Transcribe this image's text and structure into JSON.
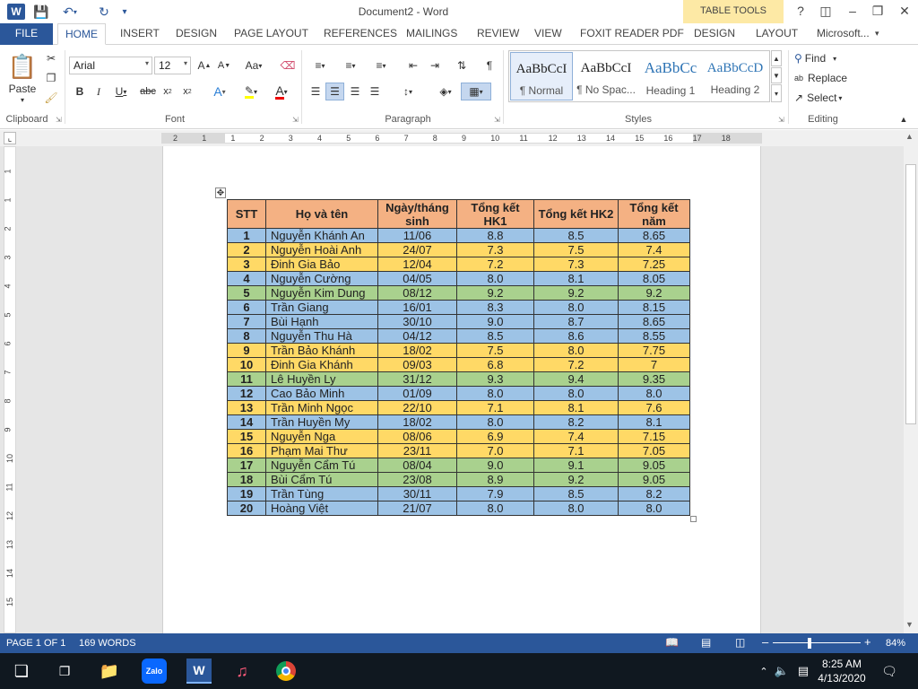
{
  "app": {
    "title": "Document2 - Word",
    "context_tab": "TABLE TOOLS",
    "logo_letter": "W"
  },
  "tabs": {
    "file": "FILE",
    "home": "HOME",
    "insert": "INSERT",
    "design": "DESIGN",
    "page_layout": "PAGE LAYOUT",
    "references": "REFERENCES",
    "mailings": "MAILINGS",
    "review": "REVIEW",
    "view": "VIEW",
    "foxit": "FOXIT READER PDF",
    "table_design": "DESIGN",
    "table_layout": "LAYOUT",
    "account": "Microsoft..."
  },
  "ribbon": {
    "paste": "Paste",
    "font_name": "Arial",
    "font_size": "12",
    "styles": [
      {
        "sample": "AaBbCcI",
        "name": "¶ Normal"
      },
      {
        "sample": "AaBbCcI",
        "name": "¶ No Spac..."
      },
      {
        "sample": "AaBbCc",
        "name": "Heading 1"
      },
      {
        "sample": "AaBbCcD",
        "name": "Heading 2"
      }
    ],
    "find": "Find",
    "replace": "Replace",
    "select": "Select",
    "groups": {
      "clipboard": "Clipboard",
      "font": "Font",
      "paragraph": "Paragraph",
      "styles": "Styles",
      "editing": "Editing"
    }
  },
  "ruler": {
    "marks": [
      "2",
      "1",
      "1",
      "2",
      "3",
      "4",
      "5",
      "6",
      "7",
      "8",
      "9",
      "10",
      "11",
      "12",
      "13",
      "14",
      "15",
      "16",
      "17",
      "18"
    ],
    "vmarks": [
      "1",
      "1",
      "2",
      "3",
      "4",
      "5",
      "6",
      "7",
      "8",
      "9",
      "10",
      "11",
      "12",
      "13",
      "14",
      "15"
    ]
  },
  "table": {
    "headers": [
      "STT",
      "Họ và tên",
      "Ngày/tháng sinh",
      "Tổng kết HK1",
      "Tổng kết HK2",
      "Tổng kết năm"
    ],
    "rows": [
      {
        "stt": "1",
        "name": "Nguyễn Khánh An",
        "dob": "11/06",
        "hk1": "8.8",
        "hk2": "8.5",
        "year": "8.65",
        "color": "blue"
      },
      {
        "stt": "2",
        "name": "Nguyễn Hoài Anh",
        "dob": "24/07",
        "hk1": "7.3",
        "hk2": "7.5",
        "year": "7.4",
        "color": "yellow"
      },
      {
        "stt": "3",
        "name": "Đinh Gia Bảo",
        "dob": "12/04",
        "hk1": "7.2",
        "hk2": "7.3",
        "year": "7.25",
        "color": "yellow"
      },
      {
        "stt": "4",
        "name": "Nguyễn Cường",
        "dob": "04/05",
        "hk1": "8.0",
        "hk2": "8.1",
        "year": "8.05",
        "color": "blue"
      },
      {
        "stt": "5",
        "name": "Nguyễn Kim Dung",
        "dob": "08/12",
        "hk1": "9.2",
        "hk2": "9.2",
        "year": "9.2",
        "color": "green"
      },
      {
        "stt": "6",
        "name": "Trần Giang",
        "dob": "16/01",
        "hk1": "8.3",
        "hk2": "8.0",
        "year": "8.15",
        "color": "blue"
      },
      {
        "stt": "7",
        "name": "Bùi Hạnh",
        "dob": "30/10",
        "hk1": "9.0",
        "hk2": "8.7",
        "year": "8.65",
        "color": "blue"
      },
      {
        "stt": "8",
        "name": "Nguyễn Thu Hà",
        "dob": "04/12",
        "hk1": "8.5",
        "hk2": "8.6",
        "year": "8.55",
        "color": "blue"
      },
      {
        "stt": "9",
        "name": "Trần Bảo Khánh",
        "dob": "18/02",
        "hk1": "7.5",
        "hk2": "8.0",
        "year": "7.75",
        "color": "yellow"
      },
      {
        "stt": "10",
        "name": "Đinh Gia Khánh",
        "dob": "09/03",
        "hk1": "6.8",
        "hk2": "7.2",
        "year": "7",
        "color": "yellow"
      },
      {
        "stt": "11",
        "name": "Lê Huyền Ly",
        "dob": "31/12",
        "hk1": "9.3",
        "hk2": "9.4",
        "year": "9.35",
        "color": "green"
      },
      {
        "stt": "12",
        "name": "Cao Bảo Minh",
        "dob": "01/09",
        "hk1": "8.0",
        "hk2": "8.0",
        "year": "8.0",
        "color": "blue"
      },
      {
        "stt": "13",
        "name": "Trần Minh Ngọc",
        "dob": "22/10",
        "hk1": "7.1",
        "hk2": "8.1",
        "year": "7.6",
        "color": "yellow"
      },
      {
        "stt": "14",
        "name": "Trần Huyền My",
        "dob": "18/02",
        "hk1": "8.0",
        "hk2": "8.2",
        "year": "8.1",
        "color": "blue"
      },
      {
        "stt": "15",
        "name": "Nguyễn Nga",
        "dob": "08/06",
        "hk1": "6.9",
        "hk2": "7.4",
        "year": "7.15",
        "color": "yellow"
      },
      {
        "stt": "16",
        "name": "Phạm Mai Thư",
        "dob": "23/11",
        "hk1": "7.0",
        "hk2": "7.1",
        "year": "7.05",
        "color": "yellow"
      },
      {
        "stt": "17",
        "name": "Nguyễn Cẩm Tú",
        "dob": "08/04",
        "hk1": "9.0",
        "hk2": "9.1",
        "year": "9.05",
        "color": "green"
      },
      {
        "stt": "18",
        "name": "Bùi Cẩm Tú",
        "dob": "23/08",
        "hk1": "8.9",
        "hk2": "9.2",
        "year": "9.05",
        "color": "green"
      },
      {
        "stt": "19",
        "name": "Trần Tùng",
        "dob": "30/11",
        "hk1": "7.9",
        "hk2": "8.5",
        "year": "8.2",
        "color": "blue"
      },
      {
        "stt": "20",
        "name": "Hoàng Việt",
        "dob": "21/07",
        "hk1": "8.0",
        "hk2": "8.0",
        "year": "8.0",
        "color": "blue"
      }
    ]
  },
  "status": {
    "page": "PAGE 1 OF 1",
    "words": "169 WORDS",
    "zoom": "84%"
  },
  "taskbar": {
    "time": "8:25 AM",
    "date": "4/13/2020",
    "zalo": "Zalo"
  },
  "colors": {
    "header": "#f4b183",
    "blue": "#9dc3e6",
    "yellow": "#ffd966",
    "green": "#a9d18e",
    "accent": "#2b579a"
  }
}
